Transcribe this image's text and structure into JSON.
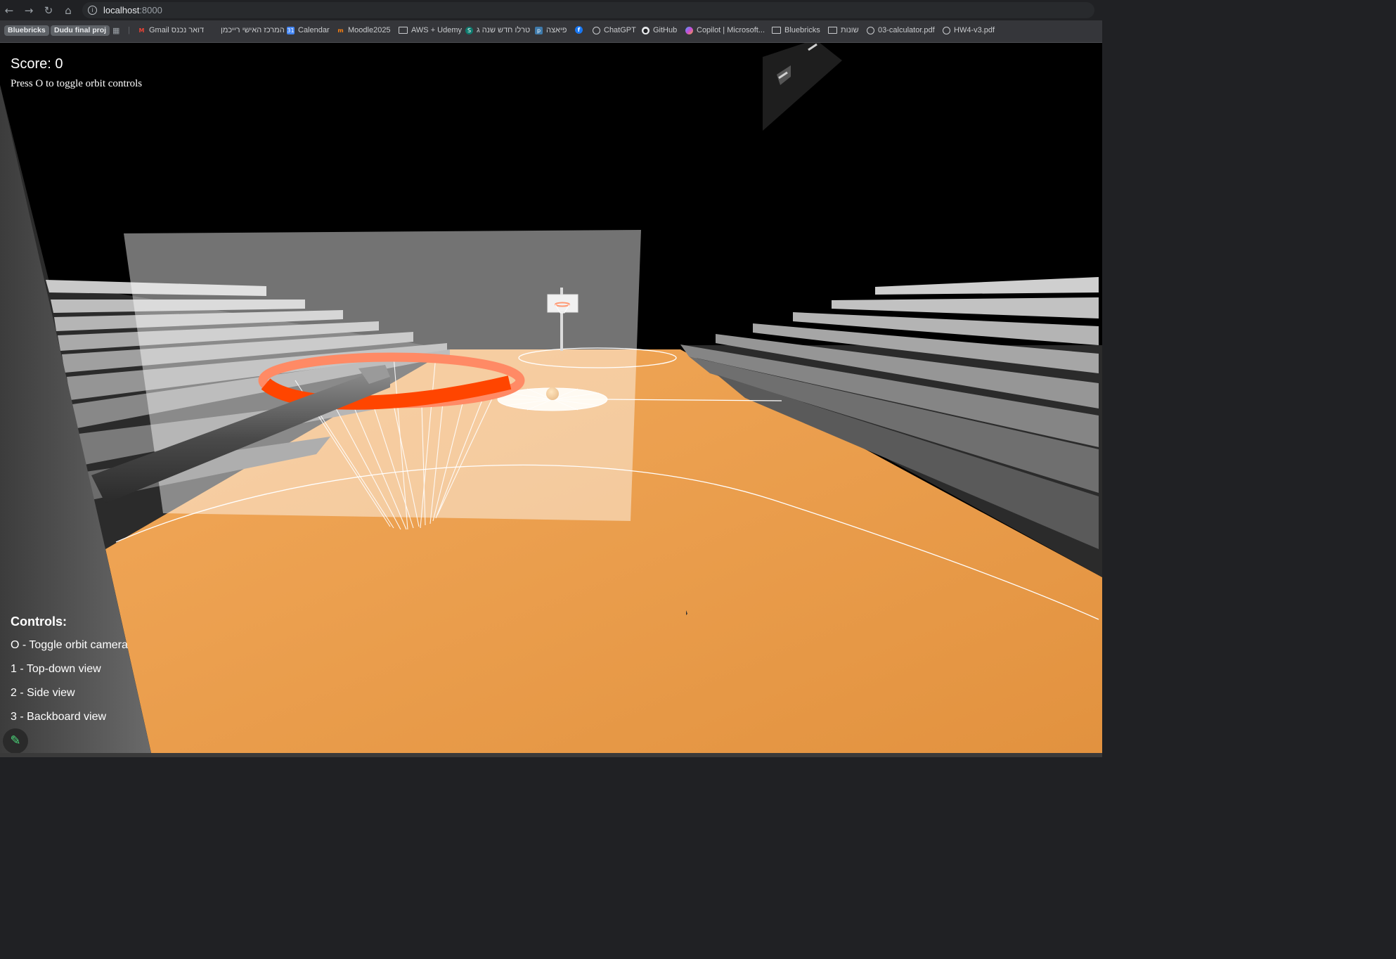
{
  "browser": {
    "url_host": "localhost",
    "url_port": ":8000",
    "bookmarks": [
      {
        "label": "Bluebricks",
        "type": "chip"
      },
      {
        "label": "Dudu final proj",
        "type": "chip"
      },
      {
        "label": "Gmail דואר נכנס",
        "type": "gmail"
      },
      {
        "label": "המרכז האישי רייכמן",
        "type": "site"
      },
      {
        "label": "Calendar",
        "type": "calendar"
      },
      {
        "label": "Moodle2025",
        "type": "moodle"
      },
      {
        "label": "AWS + Udemy",
        "type": "folder"
      },
      {
        "label": "טרלו חדש שנה ג",
        "type": "trello"
      },
      {
        "label": "פיאצה",
        "type": "piazza"
      },
      {
        "label": "",
        "type": "facebook"
      },
      {
        "label": "ChatGPT",
        "type": "chatgpt"
      },
      {
        "label": "GitHub",
        "type": "github"
      },
      {
        "label": "Copilot | Microsoft...",
        "type": "copilot"
      },
      {
        "label": "Bluebricks",
        "type": "folder"
      },
      {
        "label": "שונות",
        "type": "folder"
      },
      {
        "label": "03-calculator.pdf",
        "type": "globe"
      },
      {
        "label": "HW4-v3.pdf",
        "type": "globe"
      }
    ]
  },
  "game": {
    "score_text": "Score: 0",
    "orbit_hint": "Press O to toggle orbit controls",
    "controls_title": "Controls:",
    "controls": [
      "O - Toggle orbit camera",
      "1 - Top-down view",
      "2 - Side view",
      "3 - Backboard view"
    ]
  },
  "colors": {
    "court": "#e89a4c",
    "rim": "#ff4500",
    "backboard": "#9a9a9a",
    "stands": "#c8c8c8"
  }
}
